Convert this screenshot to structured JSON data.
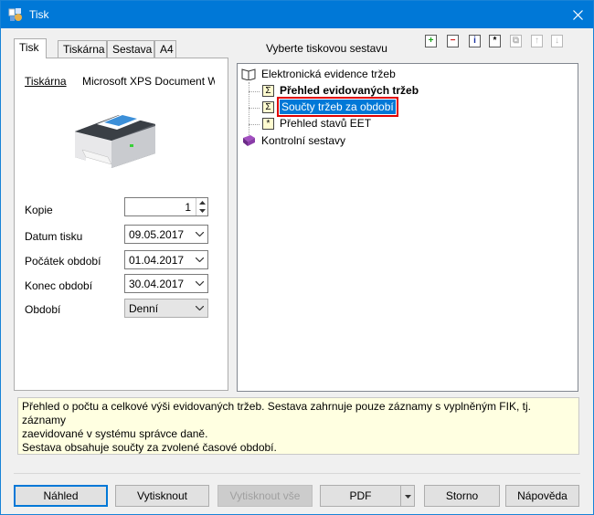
{
  "window": {
    "title": "Tisk",
    "titlebar_color": "#0078d7"
  },
  "tabs": [
    {
      "label": "Tisk",
      "active": true
    },
    {
      "label": "Tiskárna",
      "active": false
    },
    {
      "label": "Sestava",
      "active": false
    },
    {
      "label": "A4",
      "active": false
    }
  ],
  "print_panel": {
    "printer_label": "Tiskárna",
    "printer_value": "Microsoft XPS Document W",
    "copies_label": "Kopie",
    "copies_value": "1",
    "print_date_label": "Datum tisku",
    "print_date_value": "09.05.2017",
    "period_start_label": "Počátek období",
    "period_start_value": "01.04.2017",
    "period_end_label": "Konec období",
    "period_end_value": "30.04.2017",
    "period_label": "Období",
    "period_value": "Denní"
  },
  "report_picker": {
    "caption": "Vyberte tiskovou sestavu",
    "toolbar_icons": [
      "add-icon",
      "remove-icon",
      "info-icon",
      "edit-icon",
      "copy-icon",
      "move-up-icon",
      "move-down-icon"
    ],
    "tree": {
      "group1": "Elektronická evidence tržeb",
      "item1": "Přehled evidovaných tržeb",
      "item2": "Součty tržeb za období",
      "item3": "Přehled stavů EET",
      "group2": "Kontrolní sestavy"
    }
  },
  "description": {
    "line1": "Přehled o počtu a celkové výši evidovaných tržeb. Sestava zahrnuje pouze záznamy s vyplněným FIK, tj. záznamy",
    "line2": "zaevidované v systému správce daně.",
    "line3": "Sestava obsahuje součty za zvolené časové období."
  },
  "buttons": {
    "preview": "Náhled",
    "print": "Vytisknout",
    "print_all": "Vytisknout vše",
    "pdf": "PDF",
    "cancel": "Storno",
    "help": "Nápověda"
  },
  "colors": {
    "selection": "#0078d7",
    "highlight_box": "#e00000",
    "description_bg": "#ffffe1"
  }
}
